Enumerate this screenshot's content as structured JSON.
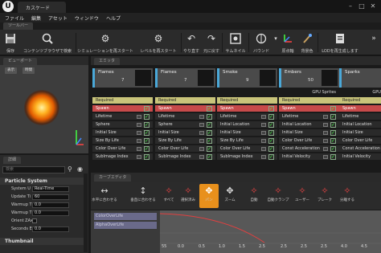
{
  "window": {
    "title": "カスケード"
  },
  "menu": [
    "ファイル",
    "編集",
    "アセット",
    "ウィンドウ",
    "ヘルプ"
  ],
  "panel_tab": "ツールバー",
  "toolbar": [
    {
      "label": "保存",
      "icon": "save-icon"
    },
    {
      "label": "コンテンツブラウザで検索",
      "icon": "search-icon"
    },
    {
      "label": "シミュレーションを再スタート",
      "icon": "gear-icon"
    },
    {
      "label": "レベルを再スタート",
      "icon": "gear-icon"
    },
    {
      "label": "やり直す",
      "icon": "undo-icon"
    },
    {
      "label": "元に戻す",
      "icon": "redo-icon"
    },
    {
      "label": "サムネイル",
      "icon": "thumbnail-icon"
    },
    {
      "label": "バウンド",
      "icon": "bounds-icon"
    },
    {
      "label": "原点軸",
      "icon": "origin-axis-icon"
    },
    {
      "label": "背景色",
      "icon": "background-color-icon"
    },
    {
      "label": "LODを再生成します",
      "icon": "lod-icon"
    }
  ],
  "viewport": {
    "tab": "ビューポート",
    "buttons": [
      "表示",
      "時間"
    ]
  },
  "details": {
    "tab": "詳細",
    "search_placeholder": "検索",
    "sections": [
      {
        "title": "Particle System",
        "props": [
          {
            "label": "System U",
            "value": "Real-Time"
          },
          {
            "label": "Update Ti",
            "value": "60"
          },
          {
            "label": "Warmup T",
            "value": "0.0"
          },
          {
            "label": "Warmup T",
            "value": "0.0"
          },
          {
            "label": "Orient ZAx",
            "value": ""
          },
          {
            "label": "Seconds E",
            "value": "0.0"
          }
        ]
      },
      {
        "title": "Thumbnail",
        "props": []
      }
    ]
  },
  "emitter": {
    "tab": "エミッタ",
    "columns": [
      {
        "name": "Flames",
        "count": "7",
        "sub": "",
        "modules": [
          "Required",
          "Spawn",
          "Lifetime",
          "Sphere",
          "Initial Size",
          "Size By Life",
          "Color Over Life",
          "SubImage Index"
        ]
      },
      {
        "name": "Flames",
        "count": "7",
        "sub": "",
        "modules": [
          "Required",
          "Spawn",
          "Lifetime",
          "Sphere",
          "Initial Size",
          "Size By Life",
          "Color Over Life",
          "SubImage Index"
        ]
      },
      {
        "name": "Smoke",
        "count": "9",
        "sub": "",
        "modules": [
          "Required",
          "Spawn",
          "Lifetime",
          "Initial Location",
          "Initial Size",
          "Size By Life",
          "Color Over Life",
          "SubImage Index"
        ]
      },
      {
        "name": "Embers",
        "count": "50",
        "sub": "GPU Sprites",
        "modules": [
          "Required",
          "Spawn",
          "Lifetime",
          "Initial Location",
          "Initial Size",
          "Color Over Life",
          "Const Acceleration",
          "Initial Velocity"
        ]
      },
      {
        "name": "Sparks",
        "count": "",
        "sub": "GPU Sprites",
        "modules": [
          "Required",
          "Spawn",
          "Lifetime",
          "Initial Location",
          "Initial Size",
          "Color Over Life",
          "Const Acceleration",
          "Initial Velocity"
        ]
      }
    ]
  },
  "curve_editor": {
    "tab": "カーブエディタ",
    "tools": [
      "水平に合わせる",
      "垂直に合わせる",
      "すべて",
      "選択済み",
      "パン",
      "ズーム",
      "自動",
      "自動クランプ",
      "ユーザー",
      "ブレーク",
      "分離する"
    ],
    "tracks": [
      "ColorOverLife",
      "AlphaOverLife"
    ],
    "axis": [
      "55",
      "0.0",
      "0.5",
      "1.0",
      "1.5",
      "2.5",
      "2.5",
      "2.5",
      "2.5",
      "4.0",
      "4.5"
    ]
  }
}
